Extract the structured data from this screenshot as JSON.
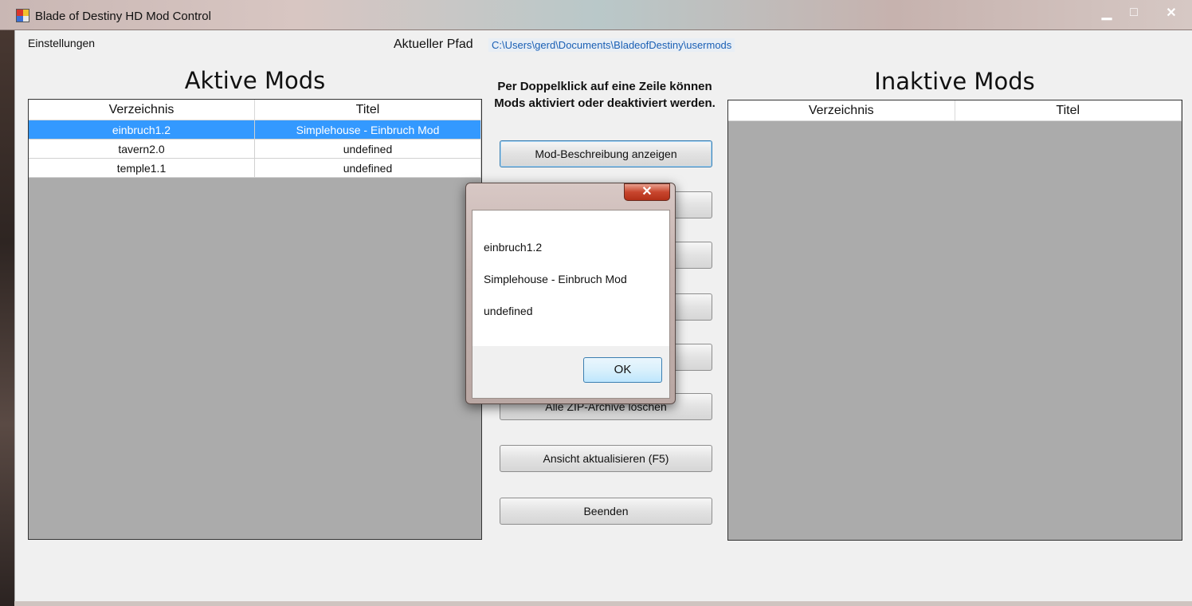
{
  "window": {
    "title": "Blade of Destiny HD Mod Control",
    "controls": {
      "minimize": "▁",
      "maximize": "□",
      "close": "✕"
    }
  },
  "menu": {
    "settings": "Einstellungen"
  },
  "path": {
    "label": "Aktueller Pfad",
    "value": "C:\\Users\\gerd\\Documents\\BladeofDestiny\\usermods"
  },
  "active_mods": {
    "heading": "Aktive Mods",
    "columns": [
      "Verzeichnis",
      "Titel"
    ],
    "rows": [
      {
        "directory": "einbruch1.2",
        "title": "Simplehouse - Einbruch Mod",
        "selected": true
      },
      {
        "directory": "tavern2.0",
        "title": "undefined",
        "selected": false
      },
      {
        "directory": "temple1.1",
        "title": "undefined",
        "selected": false
      }
    ]
  },
  "inactive_mods": {
    "heading": "Inaktive Mods",
    "columns": [
      "Verzeichnis",
      "Titel"
    ],
    "rows": []
  },
  "hint": "Per Doppelklick auf eine Zeile können Mods aktiviert oder deaktiviert werden.",
  "buttons": {
    "show_description": "Mod-Beschreibung anzeigen",
    "btn2": "",
    "btn3": "",
    "btn4": "",
    "btn5": "",
    "delete_zip": "Alle ZIP-Archive löschen",
    "refresh": "Ansicht aktualisieren (F5)",
    "quit": "Beenden"
  },
  "dialog": {
    "close_glyph": "✕",
    "lines": [
      "einbruch1.2",
      "Simplehouse - Einbruch Mod",
      "undefined"
    ],
    "ok": "OK"
  },
  "colors": {
    "selection": "#3399ff",
    "path_link": "#1a5fb4",
    "grid_empty": "#ababab"
  }
}
